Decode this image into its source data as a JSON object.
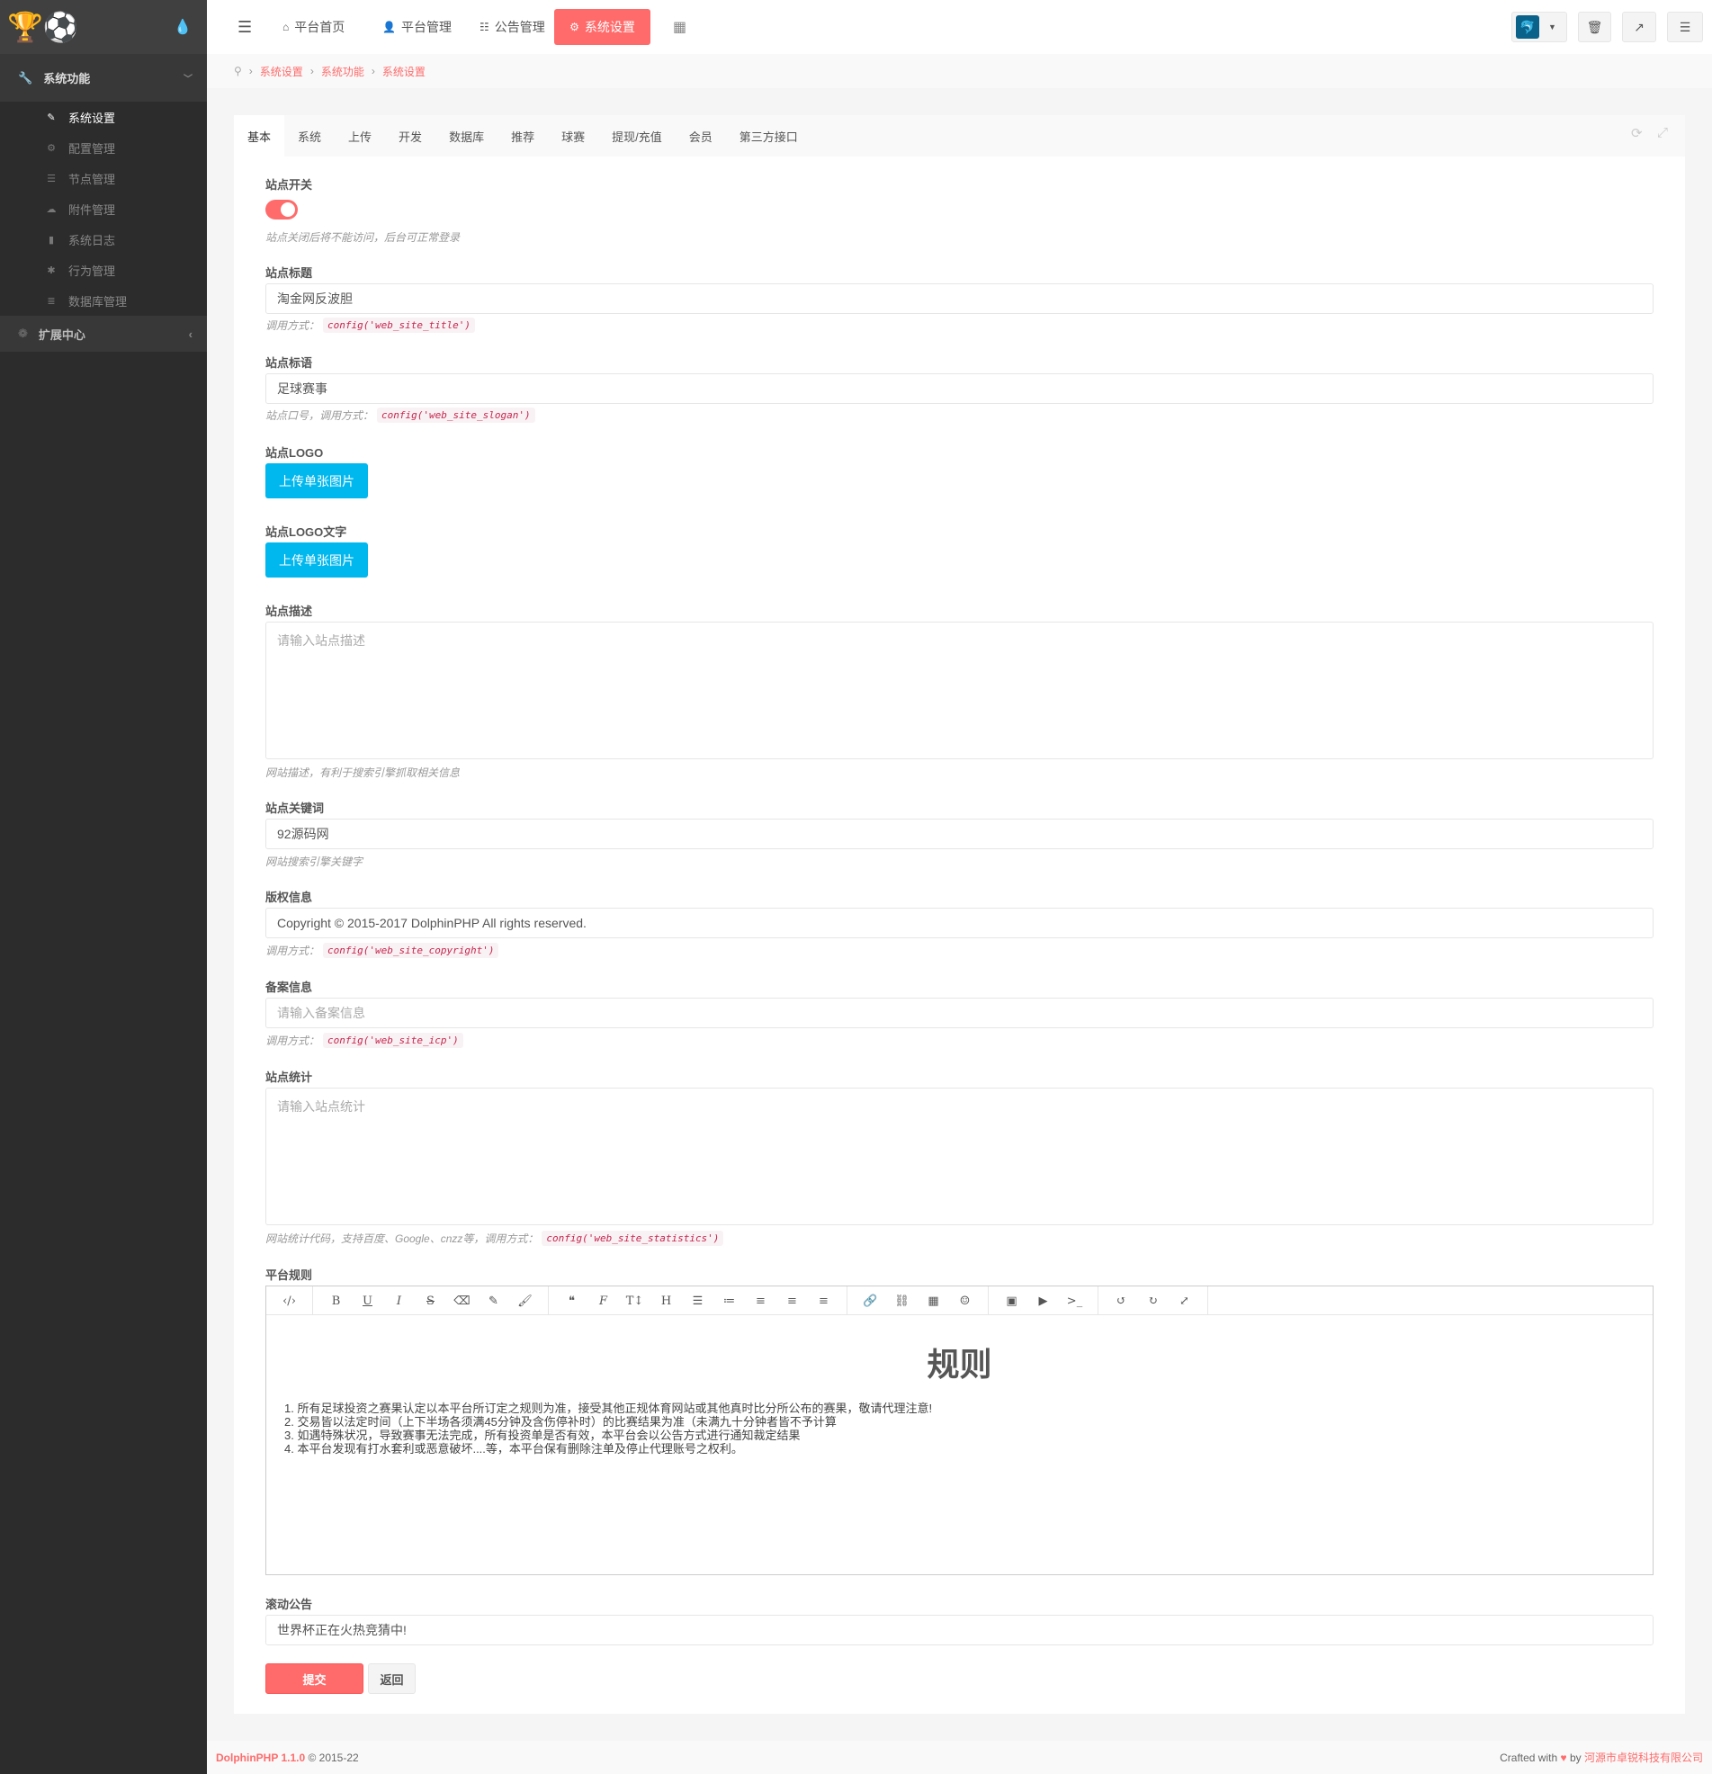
{
  "sidebar": {
    "group": "系统功能",
    "items": [
      {
        "label": "系统设置",
        "icon": "wrench-icon"
      },
      {
        "label": "配置管理",
        "icon": "gears-icon"
      },
      {
        "label": "节点管理",
        "icon": "list-icon"
      },
      {
        "label": "附件管理",
        "icon": "cloud-upload-icon"
      },
      {
        "label": "系统日志",
        "icon": "book-icon"
      },
      {
        "label": "行为管理",
        "icon": "bug-icon"
      },
      {
        "label": "数据库管理",
        "icon": "database-icon"
      }
    ],
    "group2": "扩展中心"
  },
  "topnav": {
    "items": [
      "平台首页",
      "平台管理",
      "公告管理",
      "系统设置"
    ]
  },
  "breadcrumb": [
    "系统设置",
    "系统功能",
    "系统设置"
  ],
  "tabs": [
    "基本",
    "系统",
    "上传",
    "开发",
    "数据库",
    "推荐",
    "球赛",
    "提现/充值",
    "会员",
    "第三方接口"
  ],
  "form": {
    "switch": {
      "label": "站点开关",
      "on": true,
      "hint": "站点关闭后将不能访问，后台可正常登录"
    },
    "title": {
      "label": "站点标题",
      "value": "淘金网反波胆",
      "hint": "调用方式：",
      "code": "config('web_site_title')"
    },
    "slogan": {
      "label": "站点标语",
      "value": "足球赛事",
      "hint": "站点口号，调用方式：",
      "code": "config('web_site_slogan')"
    },
    "logo": {
      "label": "站点LOGO",
      "button": "上传单张图片"
    },
    "logo_text": {
      "label": "站点LOGO文字",
      "button": "上传单张图片"
    },
    "description": {
      "label": "站点描述",
      "placeholder": "请输入站点描述",
      "hint": "网站描述，有利于搜索引擎抓取相关信息"
    },
    "keywords": {
      "label": "站点关键词",
      "value": "92源码网",
      "hint": "网站搜索引擎关键字"
    },
    "copyright": {
      "label": "版权信息",
      "value": "Copyright © 2015-2017 DolphinPHP All rights reserved.",
      "hint": "调用方式：",
      "code": "config('web_site_copyright')"
    },
    "icp": {
      "label": "备案信息",
      "placeholder": "请输入备案信息",
      "hint": "调用方式：",
      "code": "config('web_site_icp')"
    },
    "statistics": {
      "label": "站点统计",
      "placeholder": "请输入站点统计",
      "hint": "网站统计代码，支持百度、Google、cnzz等，调用方式：",
      "code": "config('web_site_statistics')"
    },
    "rules": {
      "label": "平台规则",
      "heading": "规则",
      "lines": [
        "1. 所有足球投资之赛果认定以本平台所订定之规则为准，接受其他正规体育网站或其他真时比分所公布的赛果，敬请代理注意!",
        "2. 交易皆以法定时间（上下半场各须满45分钟及含伤停补时）的比赛结果为准（未满九十分钟者皆不予计算",
        "3. 如遇特殊状况，导致赛事无法完成，所有投资单是否有效，本平台会以公告方式进行通知裁定结果",
        "4. 本平台发现有打水套利或恶意破坏....等，本平台保有删除注单及停止代理账号之权利。"
      ]
    },
    "marquee": {
      "label": "滚动公告",
      "value": "世界杯正在火热竞猜中!"
    },
    "submit": "提交",
    "back": "返回"
  },
  "footer": {
    "brand": "DolphinPHP 1.1.0",
    "years": "© 2015-22",
    "crafted": "Crafted with",
    "by": "by",
    "company": "河源市卓锐科技有限公司"
  },
  "colors": {
    "accent": "#ff6b6b",
    "upload": "#00b7ee"
  }
}
